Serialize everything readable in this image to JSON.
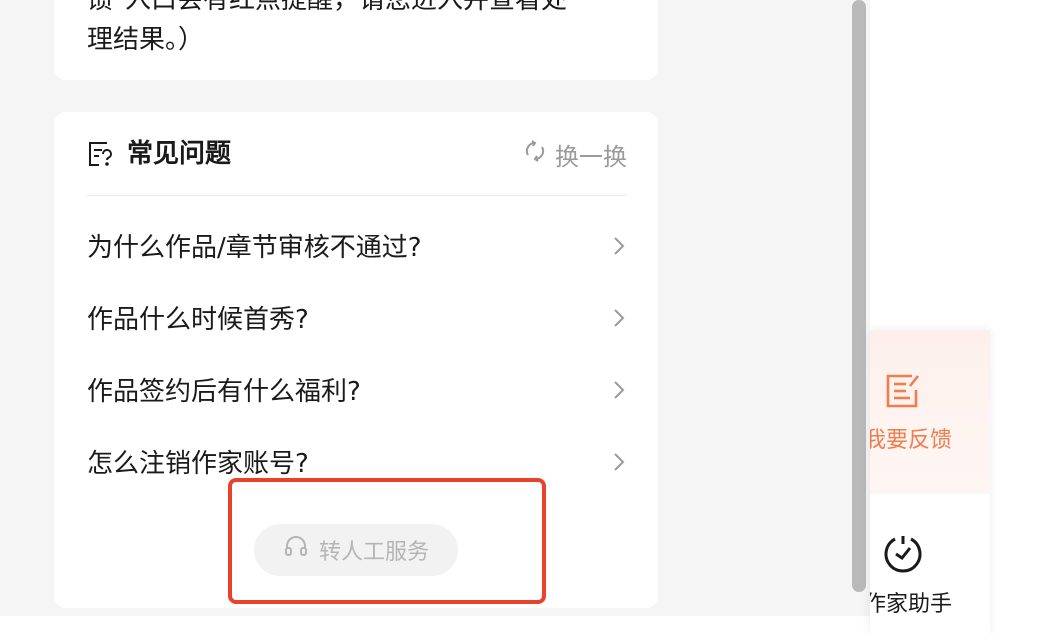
{
  "notice": {
    "text": "馈\"入口会有红点提醒，请您进入并查看处\n理结果。）"
  },
  "faq": {
    "title": "常见问题",
    "refresh_label": "换一换",
    "items": [
      {
        "question": "为什么作品/章节审核不通过?"
      },
      {
        "question": "作品什么时候首秀?"
      },
      {
        "question": "作品签约后有什么福利?"
      },
      {
        "question": "怎么注销作家账号?"
      }
    ],
    "human_service_label": "转人工服务"
  },
  "side_widget": {
    "feedback_label": "我要反馈",
    "assistant_label": "作家助手"
  },
  "colors": {
    "accent_orange": "#f07d4e",
    "highlight_red": "#e8412c",
    "disabled_gray": "#b5b5b5"
  },
  "icons": {
    "faq": "doc-question-icon",
    "refresh": "refresh-icon",
    "chevron": "chevron-right-icon",
    "headset": "headset-icon",
    "feedback": "edit-note-icon",
    "assistant": "power-clock-icon"
  }
}
